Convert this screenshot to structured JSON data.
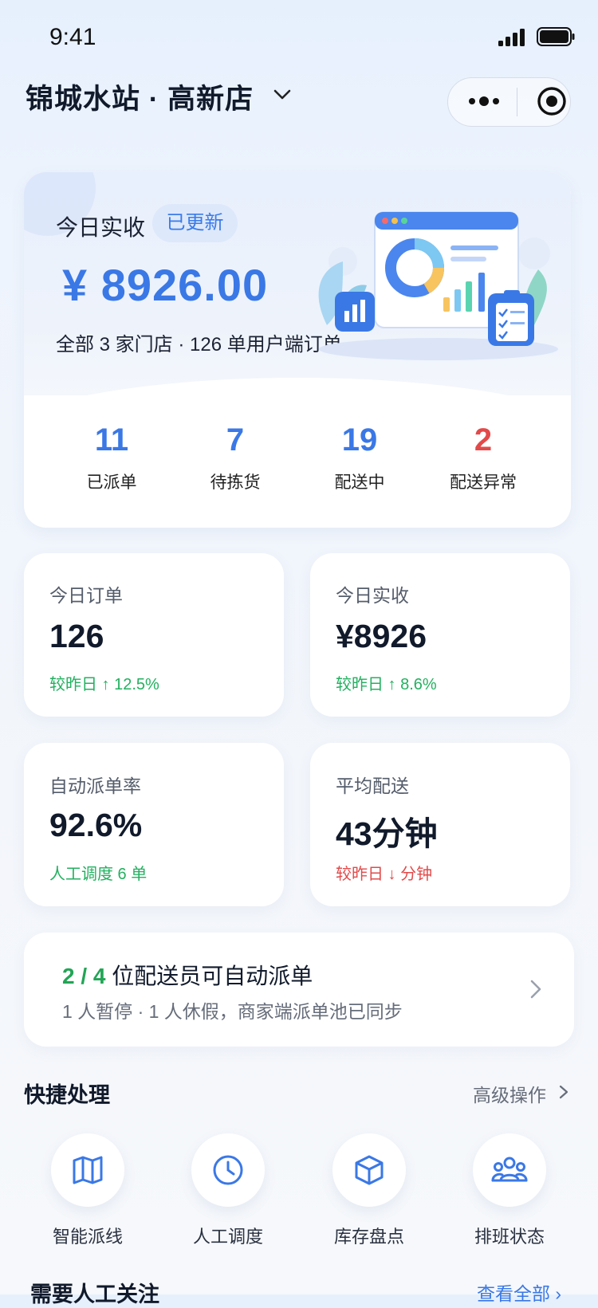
{
  "status_bar": {
    "time": "9:41"
  },
  "header": {
    "store_title": "锦城水站 · 高新店"
  },
  "hero": {
    "label": "今日实收",
    "badge": "已更新",
    "amount": "¥ 8926.00",
    "summary": "全部 3 家门店 · 126 单用户端订单",
    "stats": [
      {
        "value": "11",
        "label": "已派单"
      },
      {
        "value": "7",
        "label": "待拣货"
      },
      {
        "value": "19",
        "label": "配送中"
      },
      {
        "value": "2",
        "label": "配送异常"
      }
    ]
  },
  "metrics": [
    {
      "label": "今日订单",
      "value": "126",
      "delta": "较昨日 ↑ 12.5%"
    },
    {
      "label": "今日实收",
      "value": "¥8926",
      "delta": "较昨日 ↑ 8.6%"
    },
    {
      "label": "自动派单率",
      "value": "92.6%",
      "delta": "人工调度 6 单"
    },
    {
      "label": "平均配送",
      "value": "43分钟",
      "delta": "较昨日 ↓ 分钟"
    }
  ],
  "rider": {
    "ratio": "2 / 4",
    "text": " 位配送员可自动派单",
    "detail": "1 人暂停 · 1 人休假，商家端派单池已同步"
  },
  "quick": {
    "title": "快捷处理",
    "more": "高级操作",
    "actions": [
      {
        "label": "智能派线",
        "icon": "map-icon"
      },
      {
        "label": "人工调度",
        "icon": "clock-icon"
      },
      {
        "label": "库存盘点",
        "icon": "box-icon"
      },
      {
        "label": "排班状态",
        "icon": "team-icon"
      }
    ]
  },
  "attention": {
    "title": "需要人工关注",
    "more": "查看全部 ›"
  },
  "colors": {
    "accent": "#3a78e6",
    "positive": "#22b05f",
    "negative": "#e24a4a"
  }
}
